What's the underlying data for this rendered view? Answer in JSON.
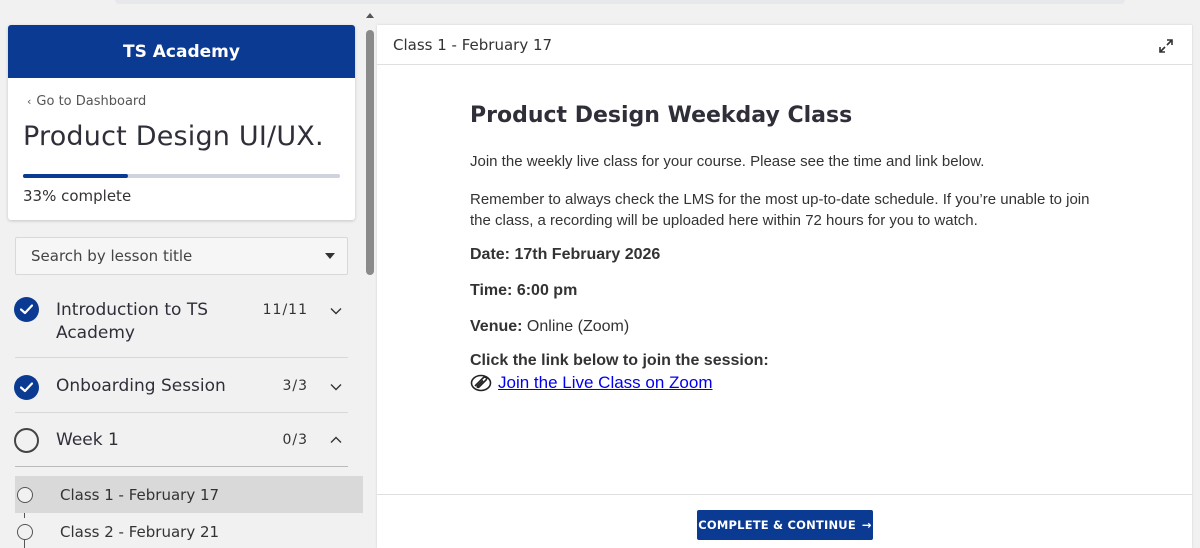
{
  "sidebar": {
    "brand": "TS Academy",
    "back_link": "Go to Dashboard",
    "course_title": "Product Design UI/UX.",
    "progress_percent": 33,
    "progress_text": "33% complete",
    "search_placeholder": "Search by lesson title",
    "sections": [
      {
        "name_line1": "Introduction to TS",
        "name_line2": "Academy",
        "count": "11/11",
        "status": "complete",
        "expanded": false
      },
      {
        "name_line1": "Onboarding Session",
        "name_line2": "",
        "count": "3/3",
        "status": "complete",
        "expanded": false
      },
      {
        "name_line1": "Week 1",
        "name_line2": "",
        "count": "0/3",
        "status": "incomplete",
        "expanded": true
      }
    ],
    "lessons": [
      {
        "name": "Class 1 - February 17",
        "active": true
      },
      {
        "name": "Class 2 - February 21",
        "active": false
      }
    ]
  },
  "panel": {
    "header_title": "Class 1 - February 17",
    "heading": "Product Design Weekday Class",
    "intro": "Join the weekly live class for your course. Please see the time and link below.",
    "reminder": "Remember to always check the LMS for the most up-to-date schedule. If you’re unable to join the class, a recording will be uploaded here within 72 hours for you to watch.",
    "date_label": "Date: 17th February 2026",
    "time_label": "Time: 6:00 pm",
    "venue_label": "Venue:",
    "venue_value": "Online (Zoom)",
    "join_heading": "Click the link below to join the session:",
    "join_link": "Join the Live Class on Zoom",
    "complete_button": "COMPLETE & CONTINUE",
    "complete_arrow": "→"
  },
  "colors": {
    "brand": "#0b3a92",
    "link": "#0000ee",
    "active_lesson_bg": "#d9d9d9"
  }
}
